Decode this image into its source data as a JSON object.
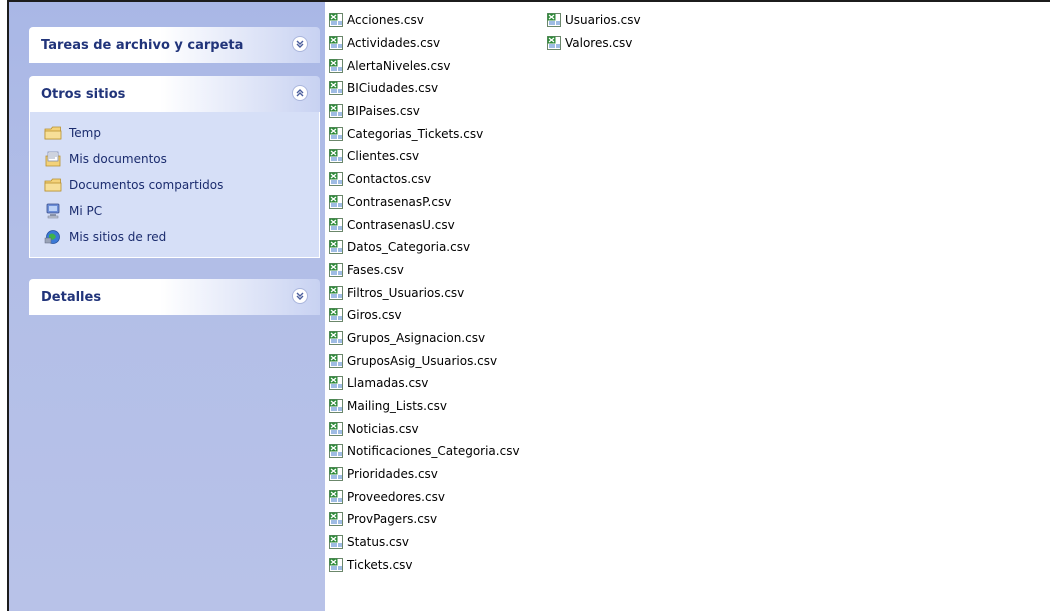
{
  "sidebar": {
    "panels": {
      "tasks": {
        "title": "Tareas de archivo y carpeta",
        "state": "collapsed"
      },
      "other_places": {
        "title": "Otros sitios",
        "state": "expanded",
        "links": [
          {
            "label": "Temp",
            "icon": "folder-icon"
          },
          {
            "label": "Mis documentos",
            "icon": "my-documents-icon"
          },
          {
            "label": "Documentos compartidos",
            "icon": "folder-icon"
          },
          {
            "label": "Mi PC",
            "icon": "my-computer-icon"
          },
          {
            "label": "Mis sitios de red",
            "icon": "network-places-icon"
          }
        ]
      },
      "details": {
        "title": "Detalles",
        "state": "collapsed"
      }
    }
  },
  "files": {
    "column1": [
      "Acciones.csv",
      "Actividades.csv",
      "AlertaNiveles.csv",
      "BICiudades.csv",
      "BIPaises.csv",
      "Categorias_Tickets.csv",
      "Clientes.csv",
      "Contactos.csv",
      "ContrasenasP.csv",
      "ContrasenasU.csv",
      "Datos_Categoria.csv",
      "Fases.csv",
      "Filtros_Usuarios.csv",
      "Giros.csv",
      "Grupos_Asignacion.csv",
      "GruposAsig_Usuarios.csv",
      "Llamadas.csv",
      "Mailing_Lists.csv",
      "Noticias.csv",
      "Notificaciones_Categoria.csv",
      "Prioridades.csv",
      "Proveedores.csv",
      "ProvPagers.csv",
      "Status.csv",
      "Tickets.csv"
    ],
    "column2": [
      "Usuarios.csv",
      "Valores.csv"
    ],
    "icon": "excel-csv-icon"
  },
  "colors": {
    "sidebar_bg": "#b5bfe7",
    "panel_title": "#21347a",
    "link_text": "#1b2c6e"
  }
}
